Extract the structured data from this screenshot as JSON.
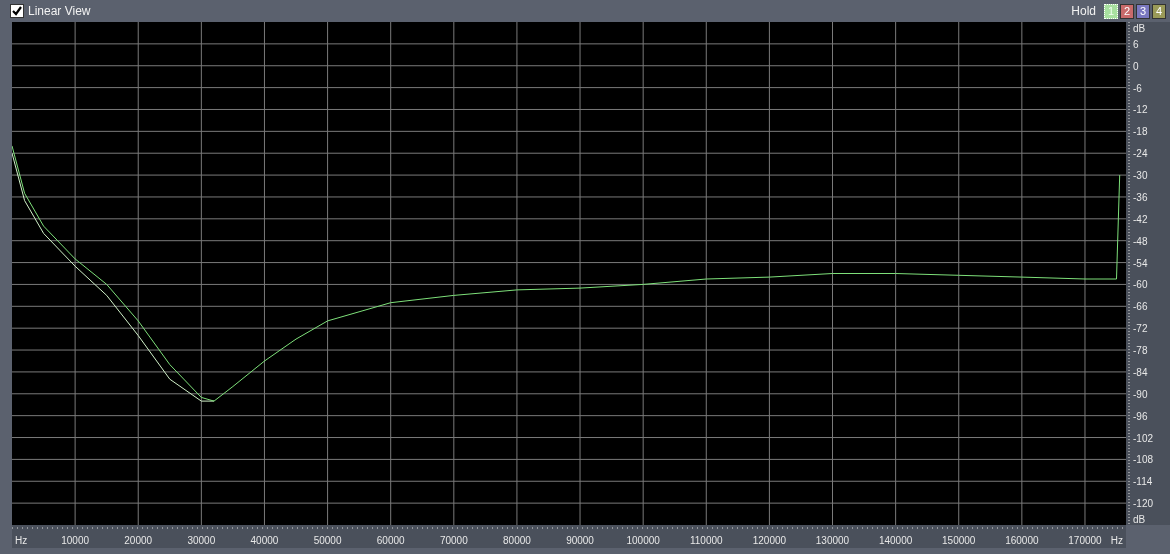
{
  "header": {
    "view_toggle": {
      "label": "Linear View",
      "checked": true
    },
    "hold": {
      "label": "Hold",
      "buttons": [
        {
          "label": "1",
          "color": "#a8e0a0",
          "selected": true
        },
        {
          "label": "2",
          "color": "#c86a6a",
          "selected": false
        },
        {
          "label": "3",
          "color": "#7a78c0",
          "selected": false
        },
        {
          "label": "4",
          "color": "#9a9a58",
          "selected": false
        }
      ]
    }
  },
  "chart_data": {
    "type": "line",
    "xlabel": "Hz",
    "ylabel": "dB",
    "xlim": [
      0,
      176500
    ],
    "ylim": [
      -126,
      12
    ],
    "grid": true,
    "x": [
      0,
      2000,
      5000,
      10000,
      15000,
      20000,
      25000,
      30000,
      32000,
      35000,
      40000,
      45000,
      50000,
      60000,
      70000,
      80000,
      90000,
      100000,
      110000,
      120000,
      130000,
      140000,
      150000,
      160000,
      170000,
      175000,
      175500
    ],
    "series": [
      {
        "color": "#7ee07a",
        "values": [
          -22,
          -35,
          -44,
          -53,
          -60,
          -70,
          -82,
          -91,
          -92,
          -88,
          -81,
          -75,
          -70,
          -65,
          -63,
          -61.5,
          -61,
          -60,
          -58.5,
          -58,
          -57,
          -57,
          -57.5,
          -58,
          -58.5,
          -58.5,
          -30
        ]
      },
      {
        "color": "#d0f0c8",
        "values": [
          -24,
          -37,
          -46,
          -55,
          -63,
          -74,
          -86,
          -92,
          -92,
          null,
          null,
          null,
          null,
          null,
          null,
          null,
          null,
          null,
          null,
          null,
          null,
          null,
          null,
          null,
          null,
          null,
          null
        ]
      }
    ],
    "xticks": [
      {
        "value": 0,
        "label": "Hz"
      },
      10000,
      20000,
      30000,
      40000,
      50000,
      60000,
      70000,
      80000,
      90000,
      100000,
      110000,
      120000,
      130000,
      140000,
      150000,
      160000,
      170000
    ],
    "yticks": [
      {
        "value": 12,
        "label": "dB"
      },
      6,
      0,
      -6,
      -12,
      -18,
      -24,
      -30,
      -36,
      -42,
      -48,
      -54,
      -60,
      -66,
      -72,
      -78,
      -84,
      -90,
      -96,
      -102,
      -108,
      -114,
      -120
    ]
  }
}
